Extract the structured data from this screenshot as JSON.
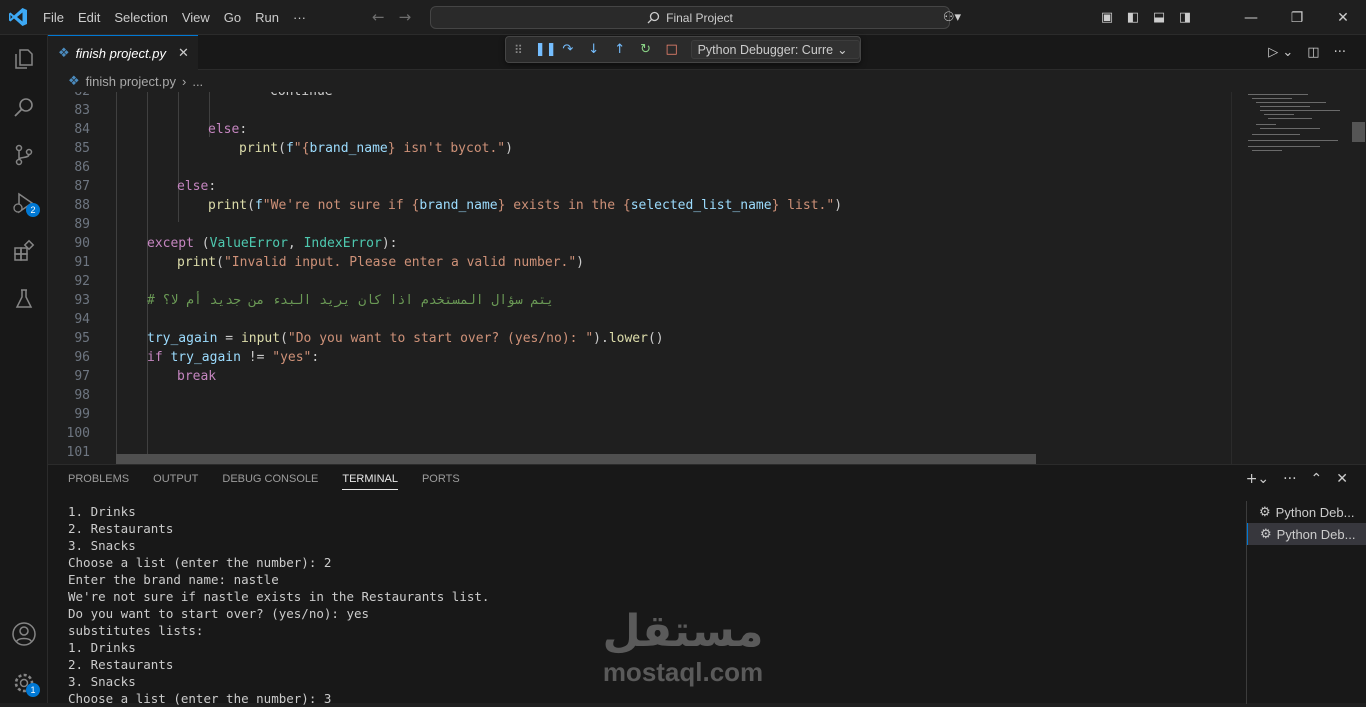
{
  "titlebar": {
    "menu": [
      "File",
      "Edit",
      "Selection",
      "View",
      "Go",
      "Run",
      "···"
    ],
    "search_text": "Final Project"
  },
  "activity": {
    "debug_badge": "2",
    "accounts_badge": "1"
  },
  "tab": {
    "label": "finish project.py",
    "close": "✕"
  },
  "debug_toolbar": {
    "config": "Python Debugger: Curre"
  },
  "breadcrumb": {
    "file": "finish project.py",
    "more": "..."
  },
  "editor": {
    "line_numbers": [
      "82",
      "83",
      "84",
      "85",
      "86",
      "87",
      "88",
      "89",
      "90",
      "91",
      "92",
      "93",
      "94",
      "95",
      "96",
      "97",
      "98",
      "99",
      "100",
      "101"
    ],
    "lines": {
      "l82": "continue",
      "l84_kw": "else",
      "l85_fn": "print",
      "l85_a": "(",
      "l85_f": "f",
      "l85_s1": "\"{",
      "l85_var": "brand_name",
      "l85_s2": "} isn't bycot.\"",
      "l85_b": ")",
      "l87_kw": "else",
      "l88_fn": "print",
      "l88_s1": "\"We're not sure if {",
      "l88_v1": "brand_name",
      "l88_s2": "} exists in the {",
      "l88_v2": "selected_list_name",
      "l88_s3": "} list.\"",
      "l90_kw": "except",
      "l90_c1": "ValueError",
      "l90_c2": "IndexError",
      "l91_fn": "print",
      "l91_s": "\"Invalid input. Please enter a valid number.\"",
      "l93_cmt": "# يتم سؤال المستخدم اذا كان يريد البدء من جديد أم لا؟",
      "l95_var": "try_again",
      "l95_fn": "input",
      "l95_s": "\"Do you want to start over? (yes/no): \"",
      "l95_m": "lower",
      "l96_kw": "if",
      "l96_var": "try_again",
      "l96_op": " != ",
      "l96_s": "\"yes\"",
      "l97_kw": "break"
    }
  },
  "panel": {
    "tabs": [
      "PROBLEMS",
      "OUTPUT",
      "DEBUG CONSOLE",
      "TERMINAL",
      "PORTS"
    ],
    "terminal_lines": [
      "1. Drinks",
      "2. Restaurants",
      "3. Snacks",
      "Choose a list (enter the number): 2",
      "Enter the brand name: nastle",
      "We're not sure if nastle exists in the Restaurants list.",
      "Do you want to start over? (yes/no): yes",
      "substitutes lists:",
      "1. Drinks",
      "2. Restaurants",
      "3. Snacks",
      "Choose a list (enter the number): 3"
    ],
    "terminals": [
      "Python Deb...",
      "Python Deb..."
    ]
  },
  "watermark": {
    "arabic": "مستقل",
    "latin": "mostaql.com"
  }
}
